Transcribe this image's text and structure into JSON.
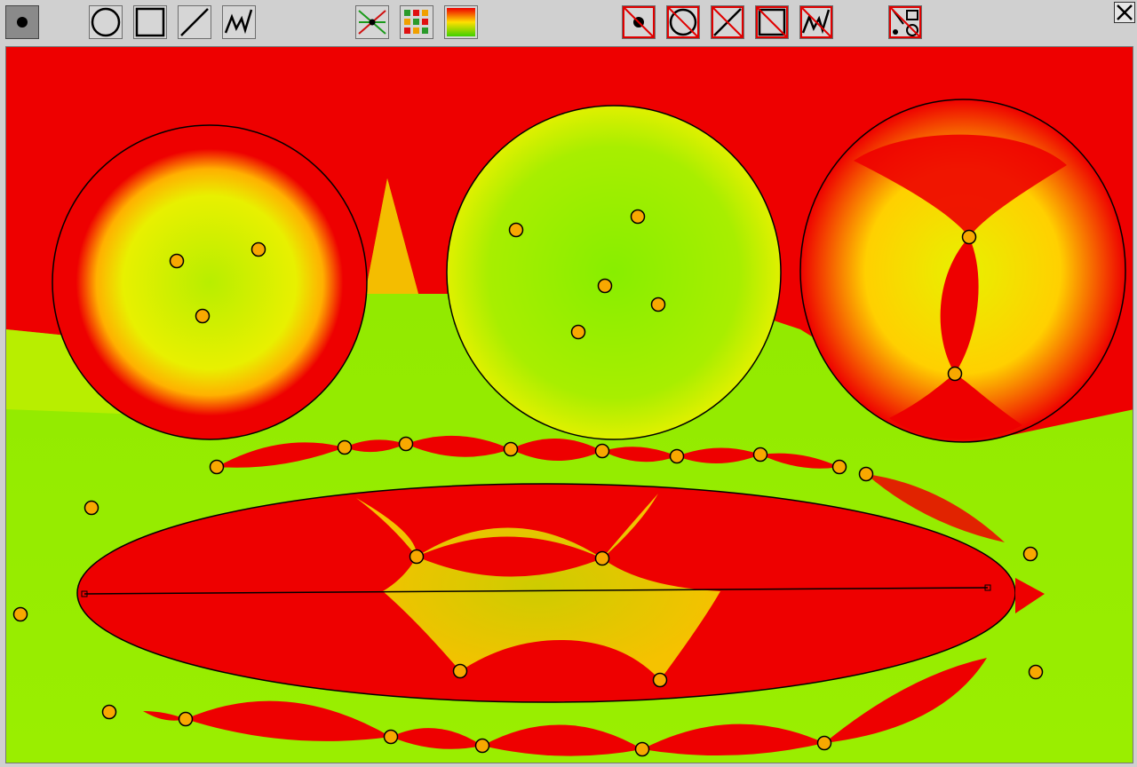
{
  "toolbar": {
    "tools": [
      {
        "id": "point-tool",
        "icon": "point-icon",
        "active": true
      },
      {
        "id": "circle-tool",
        "icon": "circle-icon",
        "active": false
      },
      {
        "id": "square-tool",
        "icon": "square-icon",
        "active": false
      },
      {
        "id": "line-tool",
        "icon": "line-icon",
        "active": false
      },
      {
        "id": "polyline-tool",
        "icon": "polyline-icon",
        "active": false
      },
      {
        "id": "voronoi-tool",
        "icon": "voronoi-icon",
        "active": false
      },
      {
        "id": "grid-color-tool",
        "icon": "grid-color-icon",
        "active": false
      },
      {
        "id": "gradient-tool",
        "icon": "gradient-icon",
        "active": false
      },
      {
        "id": "delete-point-tool",
        "icon": "delete-point-icon",
        "active": false
      },
      {
        "id": "delete-circle-tool",
        "icon": "delete-circle-icon",
        "active": false
      },
      {
        "id": "delete-line-tool",
        "icon": "delete-line-icon",
        "active": false
      },
      {
        "id": "delete-square-tool",
        "icon": "delete-square-icon",
        "active": false
      },
      {
        "id": "delete-polyline-tool",
        "icon": "delete-polyline-icon",
        "active": false
      },
      {
        "id": "clear-all-tool",
        "icon": "clear-all-icon",
        "active": false
      }
    ],
    "close_icon": "close-icon"
  },
  "colors": {
    "far": "#ee0000",
    "mid": "#ffd400",
    "near": "#90ee00",
    "point_fill": "#f8a800",
    "outline": "#000000"
  },
  "canvas": {
    "circles_count": 3,
    "ellipse_count": 1,
    "points_count": 37
  }
}
